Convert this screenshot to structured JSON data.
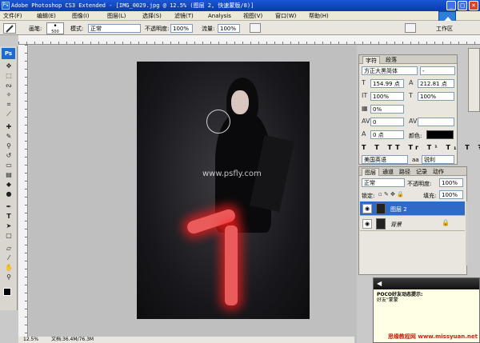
{
  "app": {
    "title": "Adobe Photoshop CS3 Extended - [IMG_0029.jpg @ 12.5% (图层 2, 快速蒙版/8)]",
    "ps_logo": "Ps"
  },
  "window_buttons": {
    "minimize": "_",
    "maximize": "□",
    "close": "×"
  },
  "menu": {
    "items": [
      "文件(F)",
      "编辑(E)",
      "图像(I)",
      "图层(L)",
      "选择(S)",
      "滤镜(T)",
      "Analysis",
      "视图(V)",
      "窗口(W)",
      "帮助(H)"
    ]
  },
  "options": {
    "brush_label": "画笔:",
    "brush_size": "500",
    "mode_label": "模式:",
    "mode_value": "正常",
    "opacity_label": "不透明度:",
    "opacity_value": "100%",
    "flow_label": "流量:",
    "flow_value": "100%",
    "workspace_label": "工作区"
  },
  "canvas": {
    "watermark": "www.psfly.com"
  },
  "status": {
    "zoom": "12.5%",
    "doc": "文档:36.4M/76.3M"
  },
  "char_panel": {
    "tabs": [
      "字符",
      "段落"
    ],
    "font_family": "方正大黑简体",
    "font_style": "-",
    "font_size": "154.99 点",
    "leading": "212.81 点",
    "vscale": "100%",
    "hscale": "100%",
    "tracking": "0%",
    "kerning": "0",
    "baseline": "0 点",
    "color_label": "颜色:",
    "style_buttons": [
      "T",
      "T",
      "TT",
      "Tr",
      "T¹",
      "T₁",
      "T",
      "Ŧ"
    ],
    "language": "美国英语",
    "aa_label": "aa",
    "aa_value": "锐利"
  },
  "layers_panel": {
    "tabs": [
      "图层",
      "通道",
      "路径",
      "记录",
      "动作"
    ],
    "blend_mode": "正常",
    "opacity_label": "不透明度:",
    "opacity_value": "100%",
    "lock_label": "锁定:",
    "fill_label": "填充:",
    "fill_value": "100%",
    "layers": [
      {
        "name": "图层 2",
        "selected": true
      },
      {
        "name": "背景",
        "selected": false
      }
    ]
  },
  "popup": {
    "title": "POCO好友动态提示:",
    "body": "好友\"蒙蒙",
    "watermark": "思缘教程网 www.missyuan.net"
  },
  "colors": {
    "titlebar": "#0d3aa8",
    "selection": "#3169c6",
    "glow": "#ff2020"
  }
}
